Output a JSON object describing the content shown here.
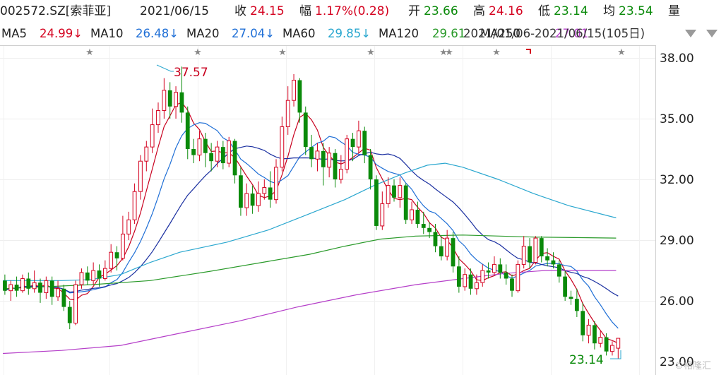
{
  "header": {
    "code_name": "002572.SZ[索菲亚]",
    "date": "2021/06/15",
    "close_label": "收",
    "close_value": "24.15",
    "change_label": "幅",
    "change_value": "1.17%(0.28)",
    "open_label": "开",
    "open_value": "23.66",
    "high_label": "高",
    "high_value": "24.16",
    "low_label": "低",
    "low_value": "23.14",
    "avg_label": "均",
    "avg_value": "23.54",
    "volume_label": "量"
  },
  "ma_bar": {
    "ma5_label": "MA5",
    "ma5_value": "24.99↓",
    "ma10_label": "MA10",
    "ma10_value": "26.48↓",
    "ma20_label": "MA20",
    "ma20_value": "27.04↓",
    "ma60_label": "MA60",
    "ma60_value": "29.85↓",
    "ma120_label": "MA120",
    "ma120_value": "29.61",
    "ma250_overlap": "MA250",
    "overlap_value": "27.01",
    "range_text": "2021/01/06-2021/06/15(105日)"
  },
  "colors": {
    "up": "#d4001e",
    "down": "#0a8a0a",
    "ma5": "#c8001e",
    "ma10": "#1f6fd6",
    "ma20": "#1a2fa0",
    "ma60": "#2aa7cf",
    "ma120": "#2a9a2a",
    "ma250": "#b53fc9"
  },
  "chart_data": {
    "type": "candlestick",
    "ylim": [
      23,
      38.5
    ],
    "yticks": [
      "38.00",
      "35.00",
      "32.00",
      "29.00",
      "26.00",
      "23.00"
    ],
    "max_annotation": "37.57",
    "min_annotation": "23.14",
    "candles": [
      [
        27.0,
        26.5,
        27.3,
        26.3
      ],
      [
        26.5,
        26.8,
        27.0,
        26.0
      ],
      [
        26.8,
        26.5,
        27.2,
        26.2
      ],
      [
        26.5,
        27.1,
        27.3,
        26.4
      ],
      [
        27.1,
        26.6,
        27.4,
        26.3
      ],
      [
        26.6,
        26.9,
        27.5,
        26.4
      ],
      [
        26.9,
        26.4,
        27.1,
        25.9
      ],
      [
        26.4,
        27.0,
        27.2,
        26.1
      ],
      [
        27.0,
        26.2,
        27.2,
        25.8
      ],
      [
        26.2,
        26.6,
        27.0,
        26.0
      ],
      [
        26.6,
        25.7,
        26.8,
        25.5
      ],
      [
        25.7,
        24.9,
        26.0,
        24.6
      ],
      [
        24.9,
        26.8,
        27.0,
        24.8
      ],
      [
        26.8,
        27.4,
        27.6,
        26.6
      ],
      [
        27.4,
        27.0,
        27.7,
        26.8
      ],
      [
        27.0,
        27.5,
        27.9,
        26.8
      ],
      [
        27.5,
        27.1,
        27.8,
        26.7
      ],
      [
        27.1,
        27.6,
        28.0,
        27.0
      ],
      [
        27.6,
        28.4,
        28.8,
        27.4
      ],
      [
        28.4,
        28.1,
        28.7,
        27.5
      ],
      [
        28.1,
        29.3,
        30.2,
        28.0
      ],
      [
        29.3,
        30.0,
        30.4,
        29.0
      ],
      [
        30.0,
        31.4,
        31.8,
        29.8
      ],
      [
        31.4,
        32.9,
        33.2,
        31.0
      ],
      [
        32.9,
        33.6,
        33.9,
        32.4
      ],
      [
        33.6,
        34.7,
        35.5,
        33.3
      ],
      [
        34.7,
        35.4,
        35.8,
        34.3
      ],
      [
        35.4,
        36.4,
        37.0,
        35.0
      ],
      [
        36.4,
        35.6,
        36.8,
        35.0
      ],
      [
        35.6,
        36.3,
        36.6,
        35.0
      ],
      [
        36.3,
        35.3,
        37.57,
        34.8
      ],
      [
        35.3,
        33.5,
        35.6,
        33.0
      ],
      [
        33.5,
        33.2,
        34.0,
        32.8
      ],
      [
        33.2,
        34.0,
        34.4,
        32.9
      ],
      [
        34.0,
        33.3,
        34.3,
        32.6
      ],
      [
        33.3,
        32.9,
        33.8,
        32.4
      ],
      [
        32.9,
        33.6,
        33.9,
        32.6
      ],
      [
        33.6,
        32.8,
        33.9,
        32.5
      ],
      [
        32.8,
        33.9,
        34.1,
        32.6
      ],
      [
        33.9,
        32.2,
        34.0,
        31.8
      ],
      [
        32.2,
        30.6,
        32.6,
        30.2
      ],
      [
        30.6,
        31.3,
        31.8,
        30.2
      ],
      [
        31.3,
        30.7,
        31.7,
        30.3
      ],
      [
        30.7,
        31.3,
        31.9,
        30.4
      ],
      [
        31.3,
        31.6,
        32.0,
        31.0
      ],
      [
        31.6,
        31.0,
        32.4,
        30.6
      ],
      [
        31.0,
        32.6,
        33.0,
        30.8
      ],
      [
        32.6,
        34.6,
        35.1,
        32.4
      ],
      [
        34.6,
        35.9,
        36.6,
        34.2
      ],
      [
        35.9,
        36.9,
        37.2,
        35.6
      ],
      [
        36.9,
        35.3,
        37.0,
        34.8
      ],
      [
        35.3,
        33.6,
        35.6,
        33.2
      ],
      [
        33.6,
        33.0,
        34.2,
        32.6
      ],
      [
        33.0,
        33.4,
        33.8,
        32.4
      ],
      [
        33.4,
        32.6,
        33.8,
        31.7
      ],
      [
        32.6,
        33.3,
        33.6,
        32.1
      ],
      [
        33.3,
        32.0,
        33.5,
        31.6
      ],
      [
        32.0,
        32.5,
        33.2,
        31.8
      ],
      [
        32.5,
        34.0,
        34.2,
        32.3
      ],
      [
        34.0,
        33.6,
        34.3,
        32.9
      ],
      [
        33.6,
        34.4,
        34.9,
        33.3
      ],
      [
        34.4,
        33.2,
        34.6,
        32.8
      ],
      [
        33.2,
        32.0,
        33.5,
        31.5
      ],
      [
        32.0,
        29.7,
        32.2,
        29.5
      ],
      [
        29.7,
        30.8,
        31.4,
        29.5
      ],
      [
        30.8,
        31.7,
        32.1,
        30.6
      ],
      [
        31.7,
        31.1,
        32.0,
        30.9
      ],
      [
        31.1,
        31.7,
        32.1,
        30.6
      ],
      [
        31.7,
        30.0,
        31.8,
        29.8
      ],
      [
        30.0,
        30.5,
        30.9,
        29.8
      ],
      [
        30.5,
        29.8,
        30.9,
        29.6
      ],
      [
        29.8,
        29.6,
        30.4,
        29.3
      ],
      [
        29.6,
        29.4,
        29.9,
        29.1
      ],
      [
        29.4,
        28.7,
        29.8,
        28.4
      ],
      [
        28.7,
        28.2,
        29.2,
        28.0
      ],
      [
        28.2,
        29.1,
        29.5,
        28.0
      ],
      [
        29.1,
        27.7,
        29.4,
        27.4
      ],
      [
        27.7,
        26.7,
        28.2,
        26.4
      ],
      [
        26.7,
        27.3,
        27.6,
        26.5
      ],
      [
        27.3,
        26.6,
        27.6,
        26.3
      ],
      [
        26.6,
        26.9,
        27.3,
        26.3
      ],
      [
        26.9,
        27.5,
        27.8,
        26.7
      ],
      [
        27.5,
        27.4,
        27.9,
        27.1
      ],
      [
        27.4,
        27.8,
        28.2,
        27.3
      ],
      [
        27.8,
        27.4,
        28.1,
        27.1
      ],
      [
        27.4,
        27.1,
        27.8,
        26.8
      ],
      [
        27.1,
        26.5,
        27.3,
        26.2
      ],
      [
        26.5,
        27.8,
        28.0,
        26.4
      ],
      [
        27.8,
        28.7,
        29.2,
        27.6
      ],
      [
        28.7,
        27.9,
        29.1,
        27.6
      ],
      [
        27.9,
        29.1,
        29.2,
        27.8
      ],
      [
        29.1,
        28.2,
        29.2,
        27.9
      ],
      [
        28.2,
        28.0,
        28.6,
        27.7
      ],
      [
        28.0,
        27.8,
        28.4,
        27.6
      ],
      [
        27.8,
        27.2,
        28.0,
        26.9
      ],
      [
        27.2,
        26.2,
        27.5,
        26.0
      ],
      [
        26.2,
        26.1,
        26.5,
        25.8
      ],
      [
        26.1,
        25.5,
        26.6,
        25.2
      ],
      [
        25.5,
        24.3,
        25.9,
        24.0
      ],
      [
        24.3,
        24.8,
        25.1,
        23.9
      ],
      [
        24.8,
        23.9,
        25.0,
        23.6
      ],
      [
        23.9,
        24.2,
        24.5,
        23.7
      ],
      [
        24.2,
        23.5,
        24.4,
        23.3
      ],
      [
        23.5,
        23.8,
        24.0,
        23.3
      ],
      [
        23.66,
        24.15,
        24.16,
        23.14
      ]
    ]
  }
}
